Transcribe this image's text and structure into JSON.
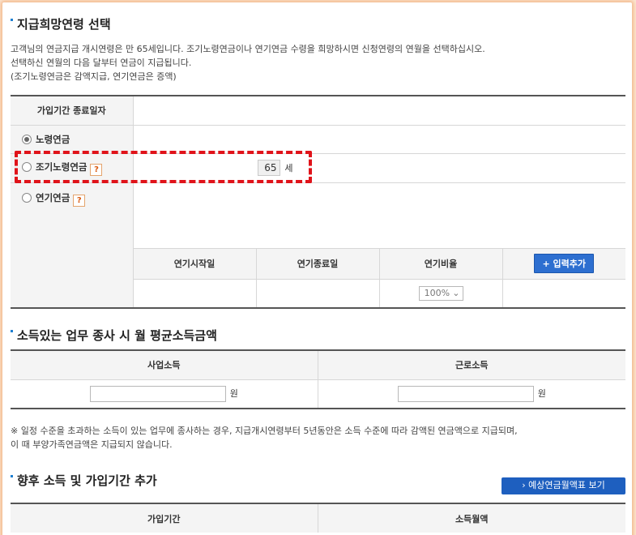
{
  "section1": {
    "title": "지급희망연령 선택",
    "desc_line1": "고객님의 연금지급 개시연령은 만 65세입니다. 조기노령연금이나 연기연금 수령을 희망하시면 신청연령의 연월을 선택하십시오.",
    "desc_line2": "선택하신 연월의 다음 달부터 연금이 지급됩니다.",
    "desc_line3": "(조기노령연금은 감액지급, 연기연금은 증액)"
  },
  "pension_table": {
    "end_date_label": "가입기간 종료일자",
    "options": [
      {
        "label": "노령연금",
        "checked": true,
        "help": false
      },
      {
        "label": "조기노령연금",
        "checked": false,
        "help": true
      },
      {
        "label": "연기연금",
        "checked": false,
        "help": true
      }
    ],
    "help_icon": "?",
    "age_value": "65",
    "age_unit": "세",
    "deferral_headers": [
      "연기시작일",
      "연기종료일",
      "연기비율"
    ],
    "add_button": "+ 입력추가",
    "ratio_select": "100%"
  },
  "section2": {
    "title": "소득있는 업무 종사 시 월 평균소득금액",
    "col1": "사업소득",
    "col2": "근로소득",
    "unit": "원",
    "note_line1": "※ 일정 수준을 초과하는 소득이 있는 업무에 종사하는 경우, 지급개시연령부터 5년동안은 소득 수준에 따라 감액된 연금액으로 지급되며,",
    "note_line2": "이 때 부양가족연금액은 지급되지 않습니다."
  },
  "section3": {
    "title": "향후 소득 및 가입기간 추가",
    "button": "› 예상연금월액표 보기",
    "col1": "가입기간",
    "col2": "소득월액"
  },
  "colors": {
    "accent": "#2d6fd0",
    "highlight": "#e0131a",
    "help": "#d95b12"
  }
}
